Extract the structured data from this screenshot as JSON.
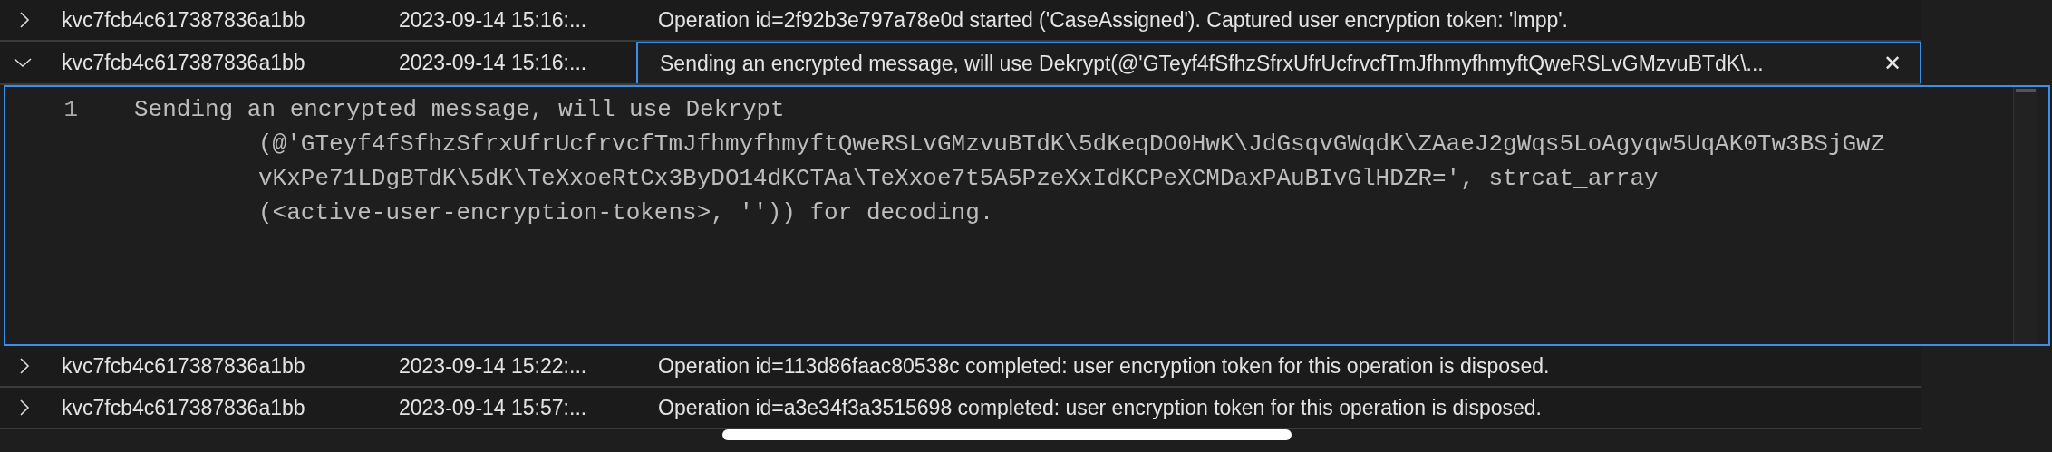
{
  "rows": [
    {
      "expanded": false,
      "id": "kvc7fcb4c617387836a1bb",
      "time": "2023-09-14 15:16:...",
      "message": "Operation id=2f92b3e797a78e0d started ('CaseAssigned'). Captured user encryption token: 'lmpp'."
    },
    {
      "expanded": true,
      "id": "kvc7fcb4c617387836a1bb",
      "time": "2023-09-14 15:16:...",
      "message": "Sending an encrypted message, will use Dekrypt(@'GTeyf4fSfhzSfrxUfrUcfrvcfTmJfhmyfhmyftQweRSLvGMzvuBTdK\\...",
      "close": "✕",
      "detail": {
        "lines": [
          {
            "number": "1",
            "segments": [
              "Sending an encrypted message, will use Dekrypt",
              "(@'GTeyf4fSfhzSfrxUfrUcfrvcfTmJfhmyfhmyftQweRSLvGMzvuBTdK\\5dKeqDO0HwK\\JdGsqvGWqdK\\ZAaeJ2gWqs5LoAgyqw5UqAK0Tw3BSjGwZ",
              "vKxPe71LDgBTdK\\5dK\\TeXxoeRtCx3ByDO14dKCTAa\\TeXxoe7t5A5PzeXxIdKCPeXCMDaxPAuBIvGlHDZR=', strcat_array",
              "(<active-user-encryption-tokens>, '')) for decoding."
            ]
          }
        ]
      }
    },
    {
      "expanded": false,
      "id": "kvc7fcb4c617387836a1bb",
      "time": "2023-09-14 15:22:...",
      "message": "Operation id=113d86faac80538c completed: user encryption token for this operation is disposed."
    },
    {
      "expanded": false,
      "id": "kvc7fcb4c617387836a1bb",
      "time": "2023-09-14 15:57:...",
      "message": "Operation id=a3e34f3a3515698 completed: user encryption token for this operation is disposed."
    }
  ]
}
